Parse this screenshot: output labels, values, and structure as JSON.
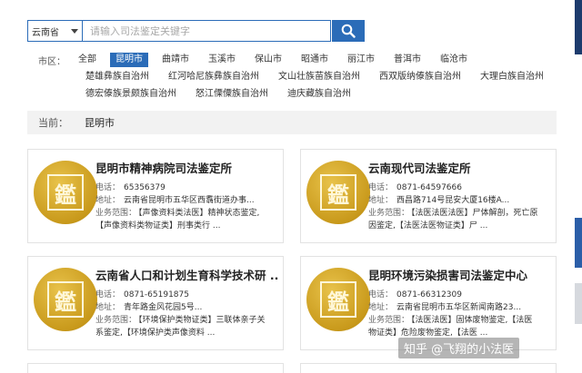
{
  "search": {
    "province": "云南省",
    "placeholder": "请输入司法鉴定关键字"
  },
  "region": {
    "label": "市区：",
    "row1": [
      "全部",
      "昆明市",
      "曲靖市",
      "玉溪市",
      "保山市",
      "昭通市",
      "丽江市",
      "普洱市",
      "临沧市"
    ],
    "row2": [
      "楚雄彝族自治州",
      "红河哈尼族彝族自治州",
      "文山壮族苗族自治州",
      "西双版纳傣族自治州",
      "大理白族自治州"
    ],
    "row3": [
      "德宏傣族景颇族自治州",
      "怒江傈僳族自治州",
      "迪庆藏族自治州"
    ],
    "active": "昆明市"
  },
  "current": {
    "label": "当前：",
    "value": "昆明市"
  },
  "cards": [
    {
      "name": "昆明市精神病院司法鉴定所",
      "phone_label": "电话：",
      "phone": "65356379",
      "addr_label": "地址：",
      "addr": "云南省昆明市五华区西翥街道办事...",
      "scope_label": "业务范围：",
      "scope1": "【声像资料类法医】精神状态鉴定,",
      "scope2": "【声像资料类物证类】刑事类行 ..."
    },
    {
      "name": "云南现代司法鉴定所",
      "phone_label": "电话：",
      "phone": "0871-64597666",
      "addr_label": "地址：",
      "addr": "西昌路714号昆安大厦16楼A...",
      "scope_label": "业务范围：",
      "scope1": "【法医法医法医】尸体解剖，死亡原",
      "scope2": "因鉴定,【法医法医物证类】尸 ..."
    },
    {
      "name": "云南省人口和计划生育科学技术研 ...",
      "phone_label": "电话：",
      "phone": "0871-65191875",
      "addr_label": "地址：",
      "addr": "青年路金风花园5号...",
      "scope_label": "业务范围：",
      "scope1": "【环境保护类物证类】三联体亲子关",
      "scope2": "系鉴定,【环境保护类声像资料 ..."
    },
    {
      "name": "昆明环境污染损害司法鉴定中心",
      "phone_label": "电话：",
      "phone": "0871-66312309",
      "addr_label": "地址：",
      "addr": "云南省昆明市五华区新闻南路23...",
      "scope_label": "业务范围：",
      "scope1": "【法医法医】固体废物鉴定,【法医",
      "scope2": "物证类】危险废物鉴定,【法医 ..."
    }
  ],
  "watermark": "知乎 @飞翔的小法医",
  "logo_glyph": "鑑",
  "colors": {
    "accent": "#2b6cb8",
    "logo_gold": "#c99a1c"
  }
}
